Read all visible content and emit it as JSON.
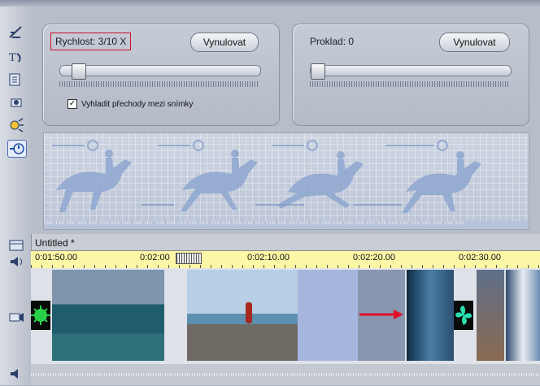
{
  "speed_panel": {
    "label": "Rychlost: 3/10 X",
    "reset_button": "Vynulovat",
    "slider_value": 0.15,
    "checkbox_label": "Vyhladit přechody mezi snímky",
    "checkbox_checked": true
  },
  "overlap_panel": {
    "label": "Proklad: 0",
    "reset_button": "Vynulovat",
    "slider_value": 0.0
  },
  "preview": {
    "frame_numbers": "198 199 200 201 202 203 204 205 206 207 208 209 210 211 212 213 214 215 216 217 218 219 220 221 222 223 224 225 226 227 228 229 230 231 232 233 234 235"
  },
  "timeline": {
    "title": "Untitled *",
    "ruler_labels": [
      "0:01:50.00",
      "0:02:00",
      "0:02:10.00",
      "0:02:20.00",
      "0:02:30.00"
    ]
  },
  "colors": {
    "highlight": "#d0102b",
    "ruler": "#fcf7a6",
    "arrow": "#e0102a"
  }
}
